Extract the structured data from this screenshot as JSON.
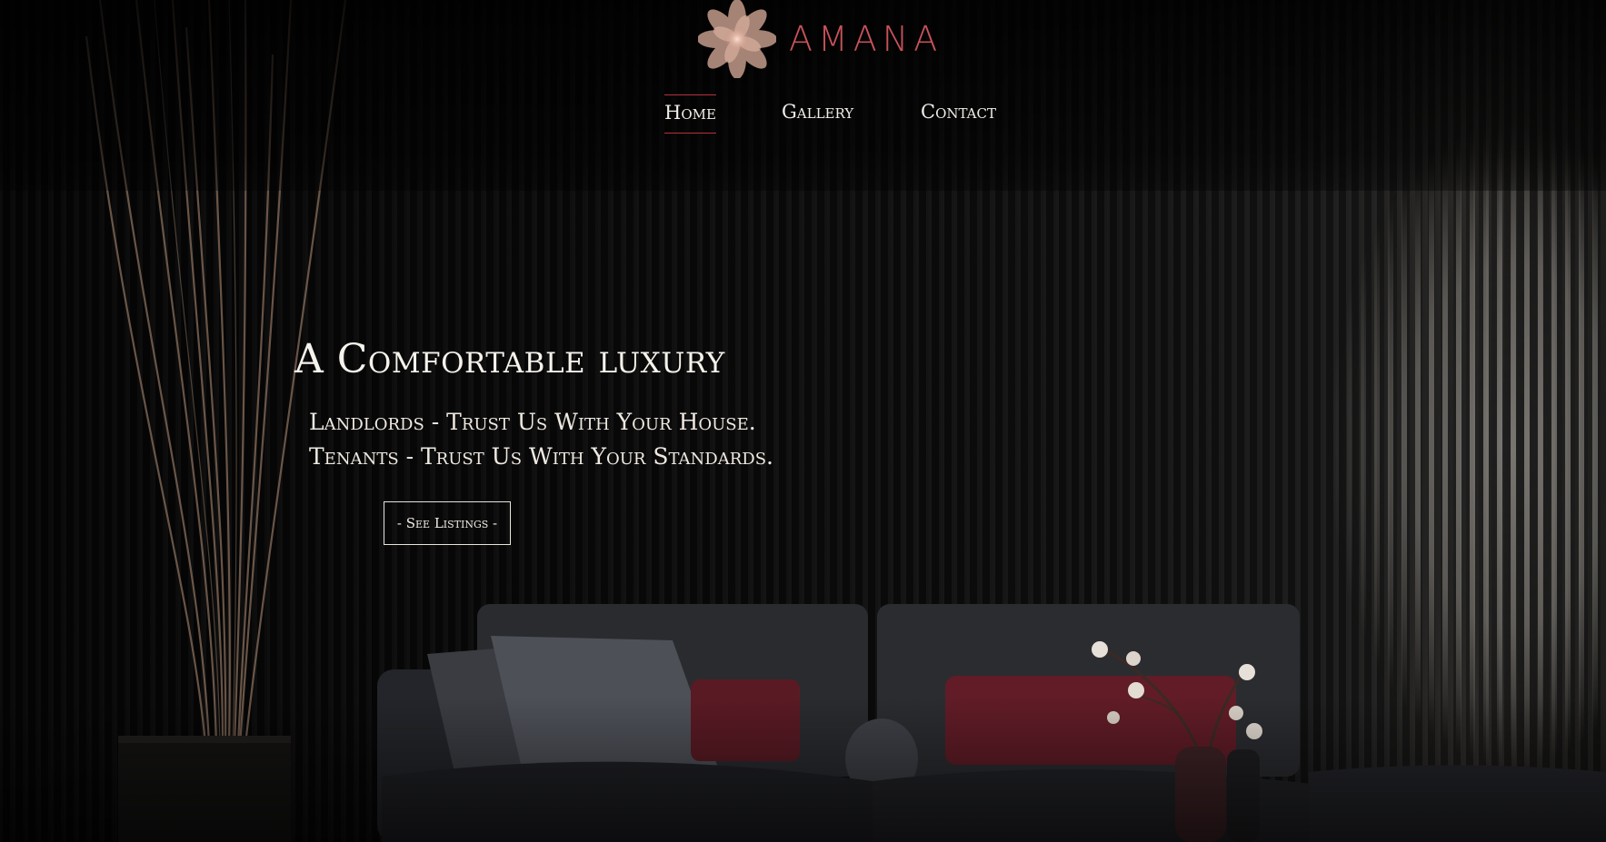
{
  "brand": {
    "name": "AMANA",
    "logo_icon": "lotus-flower-icon",
    "colors": {
      "brand_name": "#c7525a",
      "logo_petal": "#caa08f",
      "logo_center": "#f3c7b3",
      "nav_active_border": "#b5323c"
    }
  },
  "nav": {
    "items": [
      {
        "label": "Home",
        "active": true
      },
      {
        "label": "Gallery",
        "active": false
      },
      {
        "label": "Contact",
        "active": false
      }
    ]
  },
  "hero": {
    "title": "A Comfortable luxury",
    "lines": [
      "Landlords - Trust Us With Your House.",
      "Tenants - Trust Us With Your Standards."
    ],
    "cta_label": "- See Listings -"
  },
  "background": {
    "image_subject": "dark living room with velvet sofa, cushions, cotton branch vase, dried reed stems and slatted wall"
  }
}
